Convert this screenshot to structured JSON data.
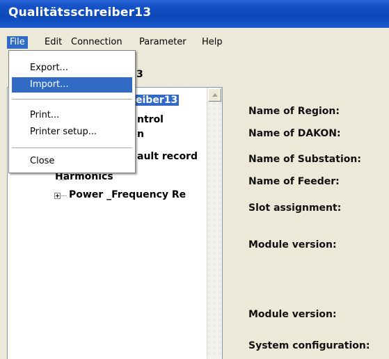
{
  "window": {
    "title": "Qualitätsschreiber13",
    "panel_label": "3"
  },
  "menubar": {
    "items": [
      {
        "label": "File",
        "active": true
      },
      {
        "label": "Edit"
      },
      {
        "label": "Connection"
      },
      {
        "label": "Parameter"
      },
      {
        "label": "Help"
      }
    ]
  },
  "file_menu": {
    "items": [
      {
        "label": "Export..."
      },
      {
        "label": "Import...",
        "highlighted": true
      },
      {
        "label": "Print..."
      },
      {
        "label": "Printer setup..."
      },
      {
        "label": "Close"
      }
    ]
  },
  "tree": {
    "visible_fragments": {
      "root": "eiber13",
      "item1": "ntrol",
      "item2": "n",
      "item3": "ault record"
    },
    "harmonics": "Harmonics",
    "power_frequency": "Power _Frequency Re"
  },
  "properties": {
    "labels": [
      "Name of Region:",
      "Name of DAKON:",
      "Name of Substation:",
      "Name of Feeder:",
      "Slot assignment:",
      "Module version:",
      "Module version:",
      "System configuration:"
    ]
  },
  "colors": {
    "selection": "#316ac5",
    "titlebar": "#0d48b9",
    "background": "#ece9d8"
  }
}
